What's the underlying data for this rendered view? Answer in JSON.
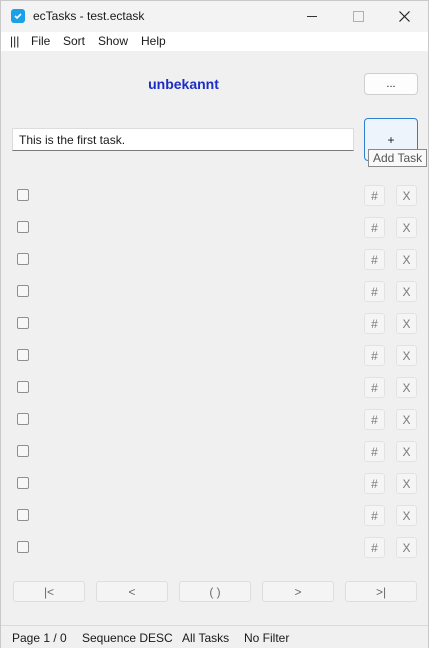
{
  "window": {
    "title": "ecTasks - test.ectask"
  },
  "menu": {
    "hamburger": "|||",
    "items": [
      "File",
      "Sort",
      "Show",
      "Help"
    ]
  },
  "header": {
    "status_title": "unbekannt",
    "more_button": "..."
  },
  "task_input": {
    "value": "This is the first task.",
    "add_button": "+",
    "tooltip": "Add Task"
  },
  "task_rows": [
    {
      "checked": false,
      "num_label": "#",
      "delete_label": "X"
    },
    {
      "checked": false,
      "num_label": "#",
      "delete_label": "X"
    },
    {
      "checked": false,
      "num_label": "#",
      "delete_label": "X"
    },
    {
      "checked": false,
      "num_label": "#",
      "delete_label": "X"
    },
    {
      "checked": false,
      "num_label": "#",
      "delete_label": "X"
    },
    {
      "checked": false,
      "num_label": "#",
      "delete_label": "X"
    },
    {
      "checked": false,
      "num_label": "#",
      "delete_label": "X"
    },
    {
      "checked": false,
      "num_label": "#",
      "delete_label": "X"
    },
    {
      "checked": false,
      "num_label": "#",
      "delete_label": "X"
    },
    {
      "checked": false,
      "num_label": "#",
      "delete_label": "X"
    },
    {
      "checked": false,
      "num_label": "#",
      "delete_label": "X"
    },
    {
      "checked": false,
      "num_label": "#",
      "delete_label": "X"
    }
  ],
  "pagination": {
    "first": "|<",
    "prev": "<",
    "current": "( )",
    "next": ">",
    "last": ">|"
  },
  "statusbar": {
    "page": "Page 1 / 0",
    "sequence": "Sequence DESC",
    "scope": "All Tasks",
    "filter": "No Filter"
  },
  "colors": {
    "accent": "#1b2dc4",
    "focus_border": "#2e7fd1",
    "app_icon": "#1aa0e6"
  }
}
